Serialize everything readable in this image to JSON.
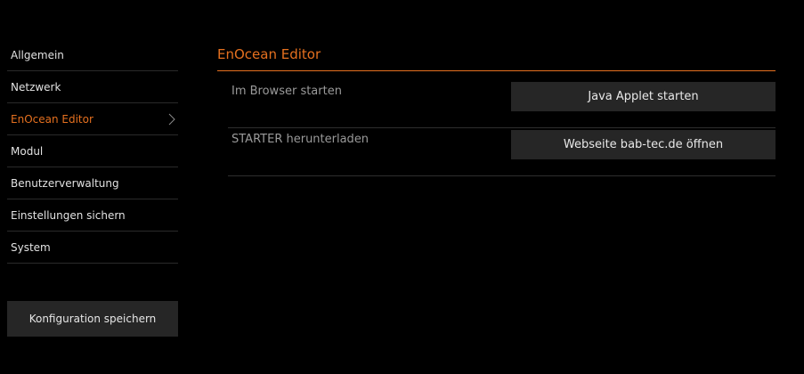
{
  "sidebar": {
    "items": [
      {
        "label": "Allgemein",
        "active": false
      },
      {
        "label": "Netzwerk",
        "active": false
      },
      {
        "label": "EnOcean Editor",
        "active": true
      },
      {
        "label": "Modul",
        "active": false
      },
      {
        "label": "Benutzerverwaltung",
        "active": false
      },
      {
        "label": "Einstellungen sichern",
        "active": false
      },
      {
        "label": "System",
        "active": false
      }
    ],
    "save_button_label": "Konfiguration speichern"
  },
  "main": {
    "title": "EnOcean Editor",
    "rows": [
      {
        "label": "Im Browser starten",
        "button_label": "Java Applet starten"
      },
      {
        "label": "STARTER herunterladen",
        "button_label": "Webseite bab-tec.de öffnen"
      }
    ]
  },
  "colors": {
    "accent": "#e5701f",
    "background": "#000000",
    "button_bg": "#262626"
  },
  "icons": {
    "active_item_chevron": "chevron-right-icon"
  }
}
